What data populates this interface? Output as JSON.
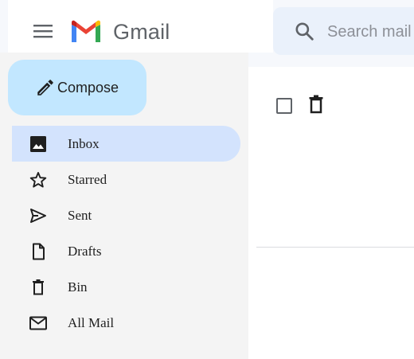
{
  "header": {
    "logo_text": "Gmail",
    "search_placeholder": "Search mail"
  },
  "compose": {
    "label": "Compose"
  },
  "sidebar": {
    "items": [
      {
        "label": "Inbox",
        "icon": "inbox-icon",
        "active": true
      },
      {
        "label": "Starred",
        "icon": "star-icon",
        "active": false
      },
      {
        "label": "Sent",
        "icon": "send-icon",
        "active": false
      },
      {
        "label": "Drafts",
        "icon": "draft-icon",
        "active": false
      },
      {
        "label": "Bin",
        "icon": "trash-icon",
        "active": false
      },
      {
        "label": "All Mail",
        "icon": "mail-icon",
        "active": false
      }
    ]
  },
  "colors": {
    "compose_bg": "#c2e7ff",
    "active_item_bg": "#d3e3fd",
    "search_bg": "#eaf1fb"
  }
}
